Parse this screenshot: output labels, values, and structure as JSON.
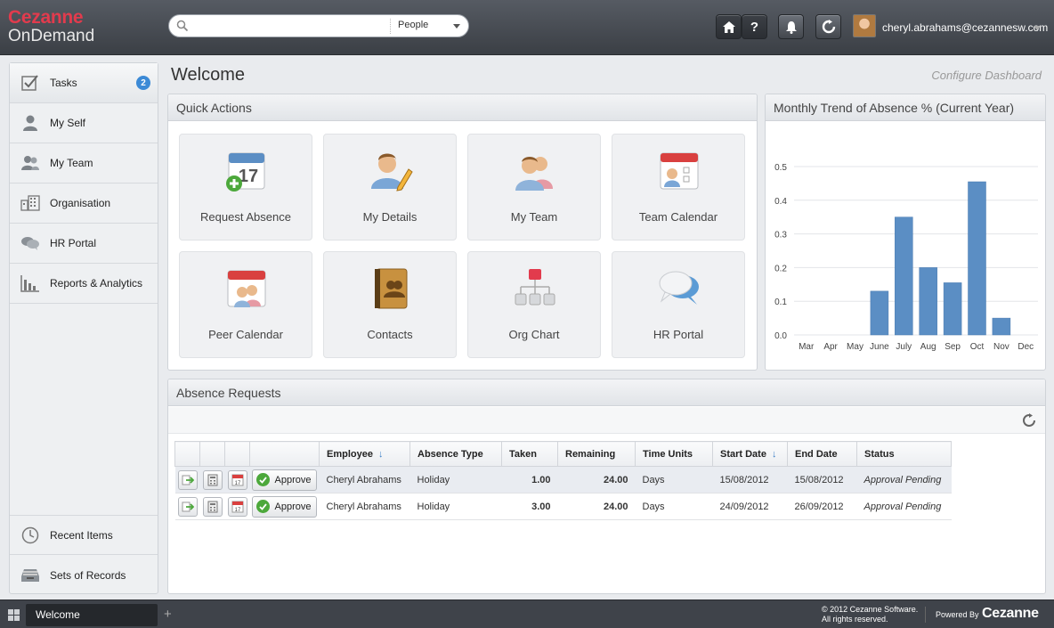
{
  "app": {
    "logo_line1": "Cezanne",
    "logo_line2": "OnDemand",
    "accent": "#e23b4d"
  },
  "search": {
    "value": "",
    "placeholder": "",
    "scope": "People"
  },
  "toolbar": {
    "home_icon": "home-icon",
    "help_label": "?",
    "alerts_icon": "bell-icon",
    "refresh_icon": "refresh-icon",
    "user_email": "cheryl.abrahams@cezannesw.com"
  },
  "sidebar": {
    "items": [
      {
        "label": "Tasks",
        "icon": "tasks-icon",
        "badge": "2"
      },
      {
        "label": "My Self",
        "icon": "person-icon"
      },
      {
        "label": "My Team",
        "icon": "team-icon"
      },
      {
        "label": "Organisation",
        "icon": "building-icon"
      },
      {
        "label": "HR Portal",
        "icon": "chat-icon"
      },
      {
        "label": "Reports & Analytics",
        "icon": "bar-chart-icon"
      }
    ],
    "bottom_items": [
      {
        "label": "Recent Items",
        "icon": "clock-icon"
      },
      {
        "label": "Sets of Records",
        "icon": "tray-icon"
      }
    ]
  },
  "main": {
    "title": "Welcome",
    "configure_link": "Configure Dashboard"
  },
  "quick_actions": {
    "title": "Quick Actions",
    "tiles": [
      {
        "label": "Request Absence",
        "icon": "calendar-add-icon"
      },
      {
        "label": "My Details",
        "icon": "person-edit-icon"
      },
      {
        "label": "My Team",
        "icon": "team-icon"
      },
      {
        "label": "Team Calendar",
        "icon": "team-calendar-icon"
      },
      {
        "label": "Peer Calendar",
        "icon": "peer-calendar-icon"
      },
      {
        "label": "Contacts",
        "icon": "address-book-icon"
      },
      {
        "label": "Org Chart",
        "icon": "org-chart-icon"
      },
      {
        "label": "HR Portal",
        "icon": "speech-bubbles-icon"
      }
    ]
  },
  "absence_chart": {
    "title": "Monthly Trend of Absence % (Current Year)"
  },
  "chart_data": {
    "type": "bar",
    "title": "Monthly Trend of Absence % (Current Year)",
    "categories": [
      "Mar",
      "Apr",
      "May",
      "June",
      "July",
      "Aug",
      "Sep",
      "Oct",
      "Nov",
      "Dec"
    ],
    "values": [
      0,
      0,
      0,
      0.13,
      0.35,
      0.2,
      0.155,
      0.455,
      0.05,
      0
    ],
    "ylim": [
      0,
      0.5
    ],
    "yticks": [
      "0.0",
      "0.1",
      "0.2",
      "0.3",
      "0.4",
      "0.5"
    ],
    "grid": true,
    "bar_color": "#5b8ec4"
  },
  "absence_requests": {
    "title": "Absence Requests",
    "columns": [
      "Employee",
      "Absence Type",
      "Taken",
      "Remaining",
      "Time Units",
      "Start Date",
      "End Date",
      "Status"
    ],
    "approve_label": "Approve",
    "rows": [
      {
        "employee": "Cheryl Abrahams",
        "type": "Holiday",
        "taken": "1.00",
        "remaining": "24.00",
        "units": "Days",
        "start": "15/08/2012",
        "end": "15/08/2012",
        "status": "Approval Pending"
      },
      {
        "employee": "Cheryl Abrahams",
        "type": "Holiday",
        "taken": "3.00",
        "remaining": "24.00",
        "units": "Days",
        "start": "24/09/2012",
        "end": "26/09/2012",
        "status": "Approval Pending"
      }
    ]
  },
  "footer": {
    "tab_label": "Welcome",
    "add_tab": "+",
    "copyright_line1": "© 2012 Cezanne Software.",
    "copyright_line2": "All rights reserved.",
    "powered_by": "Powered By",
    "brand": "Cezanne"
  }
}
